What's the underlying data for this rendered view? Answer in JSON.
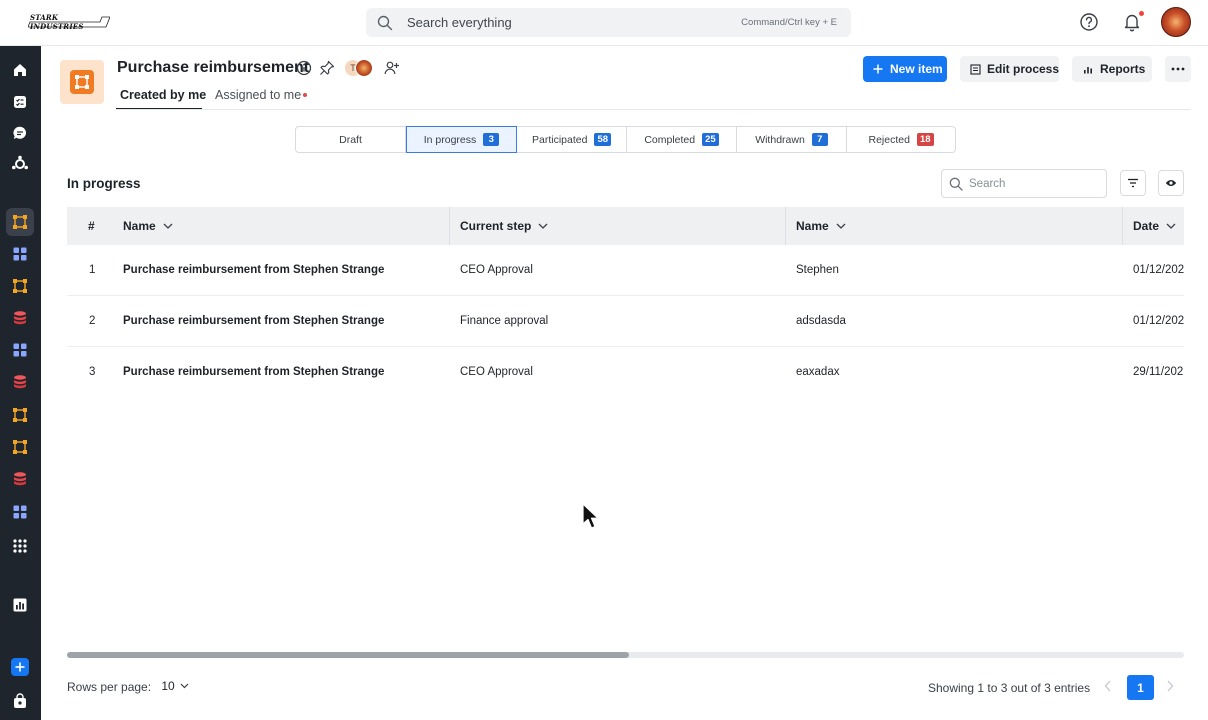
{
  "brand": {
    "logo_text": "STARK INDUSTRIES"
  },
  "search": {
    "placeholder": "Search everything",
    "shortcut_hint": "Command/Ctrl key + E"
  },
  "process": {
    "title": "Purchase reimbursement",
    "avatar_initial": "T",
    "tabs": [
      {
        "label": "Created by me",
        "active": true
      },
      {
        "label": "Assigned to me",
        "has_notification_dot": true
      }
    ]
  },
  "actions": {
    "new_item": "New item",
    "edit_process": "Edit process",
    "reports": "Reports"
  },
  "status_segments": [
    {
      "label": "Draft"
    },
    {
      "label": "In progress",
      "count": "3",
      "badge_color": "#1f6fd6",
      "active": true
    },
    {
      "label": "Participated",
      "count": "58",
      "badge_color": "#1f6fd6"
    },
    {
      "label": "Completed",
      "count": "25",
      "badge_color": "#1f6fd6"
    },
    {
      "label": "Withdrawn",
      "count": "7",
      "badge_color": "#1f6fd6"
    },
    {
      "label": "Rejected",
      "count": "18",
      "badge_color": "#d64545"
    }
  ],
  "section": {
    "title": "In progress",
    "search_placeholder": "Search"
  },
  "table": {
    "columns": [
      "#",
      "Name",
      "Current step",
      "Name",
      "Date"
    ],
    "rows": [
      [
        "1",
        "Purchase reimbursement from Stephen Strange",
        "CEO Approval",
        "Stephen",
        "01/12/202"
      ],
      [
        "2",
        "Purchase reimbursement from Stephen Strange",
        "Finance approval",
        "adsdasda",
        "01/12/202"
      ],
      [
        "3",
        "Purchase reimbursement from Stephen Strange",
        "CEO Approval",
        "eaxadax",
        "29/11/202"
      ]
    ]
  },
  "footer": {
    "rows_per_page_label": "Rows per page:",
    "rows_per_page_value": "10",
    "showing_text": "Showing 1 to 3 out of 3 entries",
    "current_page": "1"
  },
  "colors": {
    "primary": "#1677f2",
    "sidebar_bg": "#1f252d",
    "process_icon": "#f07b22",
    "danger": "#d64545"
  }
}
